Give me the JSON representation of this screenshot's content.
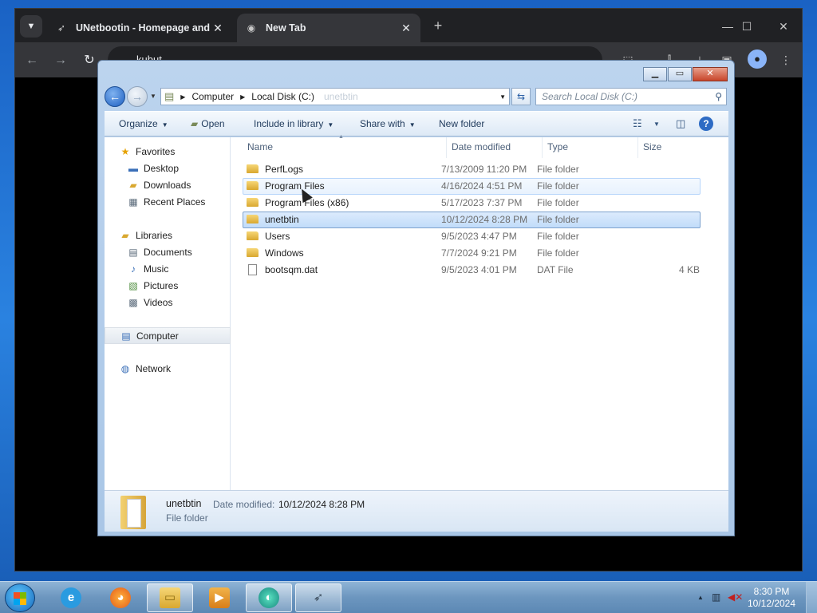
{
  "browser": {
    "tabs": [
      {
        "title": "UNetbootin - Homepage and D",
        "icon": "rocket-icon"
      },
      {
        "title": "New Tab",
        "icon": "globe-icon"
      }
    ],
    "omnibox_text": "kubut"
  },
  "explorer": {
    "breadcrumb": [
      "Computer",
      "Local Disk (C:)"
    ],
    "address_ghost": "unetbtin",
    "search_placeholder": "Search Local Disk (C:)",
    "commands": {
      "organize": "Organize",
      "open": "Open",
      "include_in_library": "Include in library",
      "share_with": "Share with",
      "new_folder": "New folder"
    },
    "nav": {
      "favorites": "Favorites",
      "favorites_items": [
        "Desktop",
        "Downloads",
        "Recent Places"
      ],
      "libraries": "Libraries",
      "libraries_items": [
        "Documents",
        "Music",
        "Pictures",
        "Videos"
      ],
      "computer": "Computer",
      "network": "Network"
    },
    "columns": {
      "name": "Name",
      "date": "Date modified",
      "type": "Type",
      "size": "Size"
    },
    "files": [
      {
        "name": "PerfLogs",
        "date": "7/13/2009 11:20 PM",
        "type": "File folder",
        "size": "",
        "kind": "folder"
      },
      {
        "name": "Program Files",
        "date": "4/16/2024 4:51 PM",
        "type": "File folder",
        "size": "",
        "kind": "folder"
      },
      {
        "name": "Program Files (x86)",
        "date": "5/17/2023 7:37 PM",
        "type": "File folder",
        "size": "",
        "kind": "folder"
      },
      {
        "name": "unetbtin",
        "date": "10/12/2024 8:28 PM",
        "type": "File folder",
        "size": "",
        "kind": "folder"
      },
      {
        "name": "Users",
        "date": "9/5/2023 4:47 PM",
        "type": "File folder",
        "size": "",
        "kind": "folder"
      },
      {
        "name": "Windows",
        "date": "7/7/2024 9:21 PM",
        "type": "File folder",
        "size": "",
        "kind": "folder"
      },
      {
        "name": "bootsqm.dat",
        "date": "9/5/2023 4:01 PM",
        "type": "DAT File",
        "size": "4 KB",
        "kind": "file"
      }
    ],
    "details": {
      "name": "unetbtin",
      "date_label": "Date modified:",
      "date_value": "10/12/2024 8:28 PM",
      "type": "File folder"
    }
  },
  "taskbar": {
    "time": "8:30 PM",
    "date": "10/12/2024"
  }
}
